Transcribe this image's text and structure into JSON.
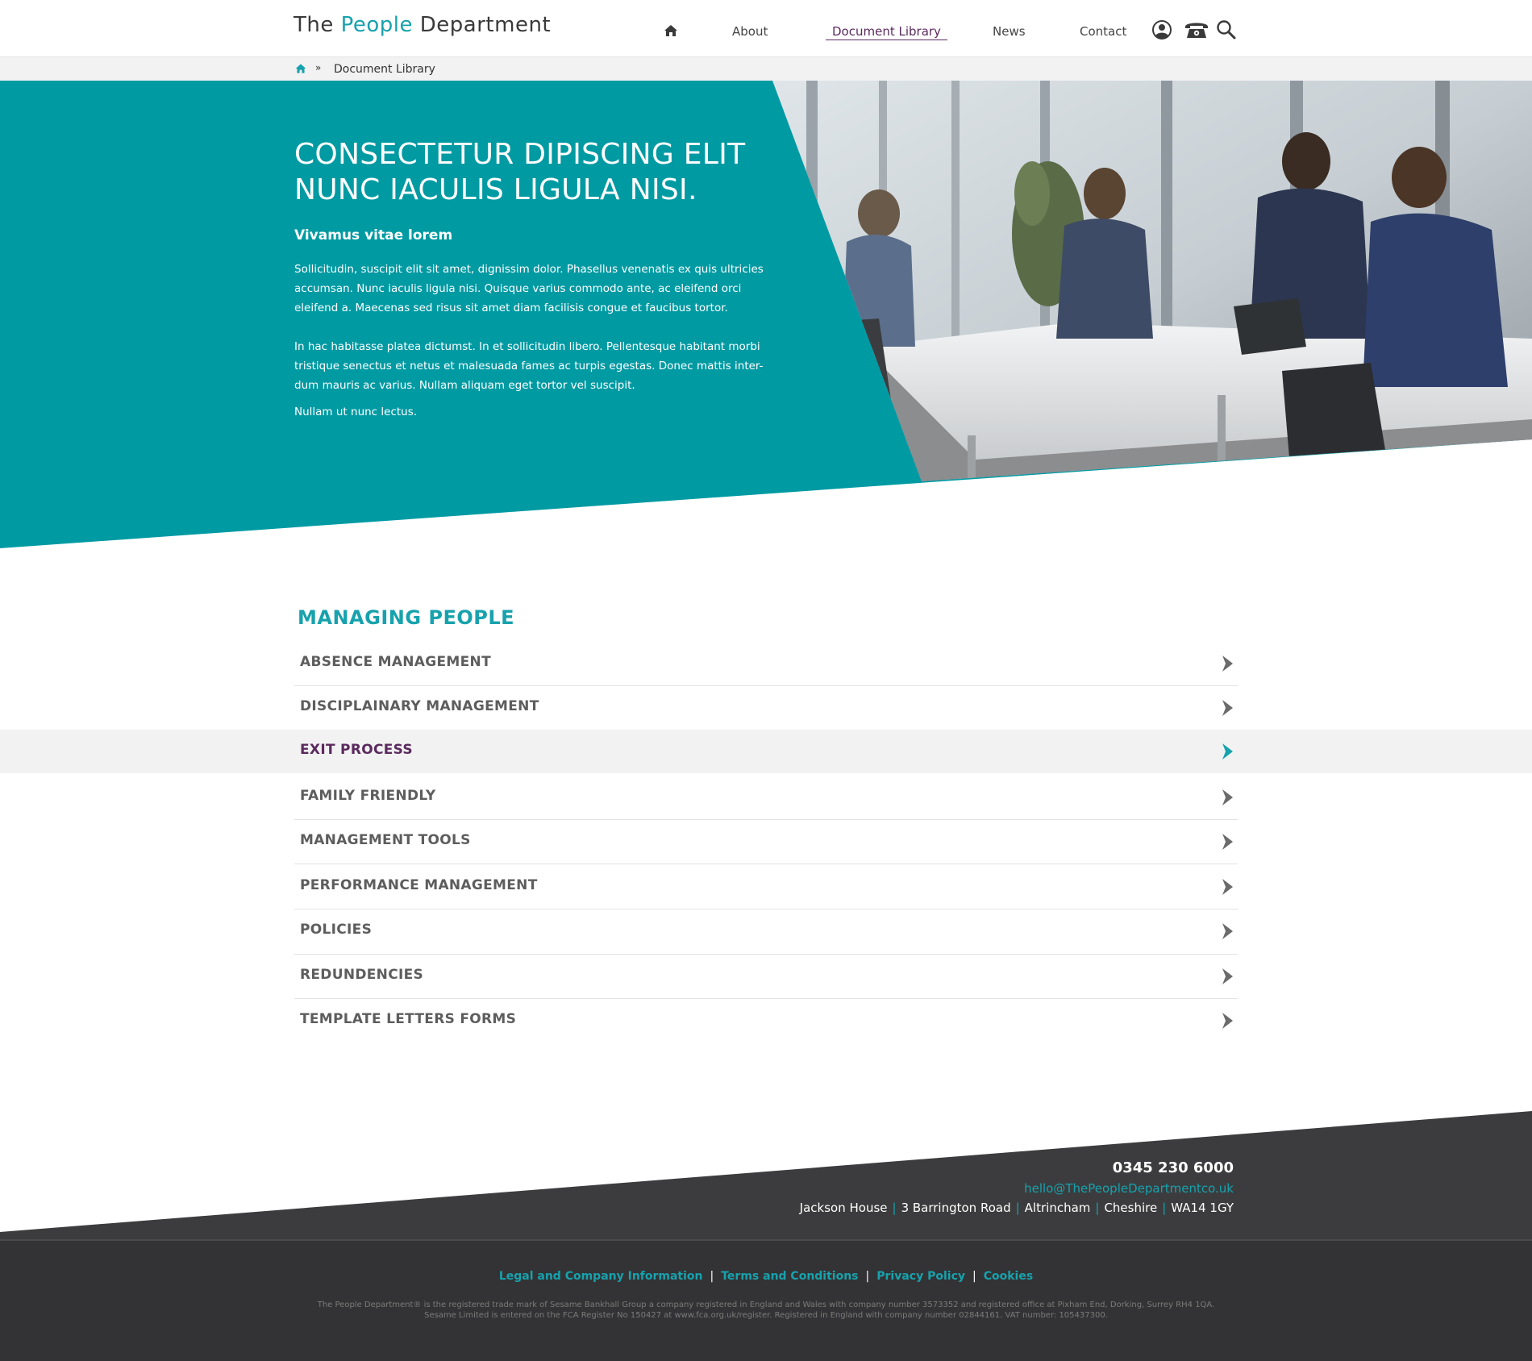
{
  "header": {
    "logo_pre": "The ",
    "logo_accent": "People",
    "logo_post": " Department",
    "nav": [
      "About",
      "Document Library",
      "News",
      "Contact"
    ],
    "active_nav": "Document Library"
  },
  "breadcrumb": {
    "current": "Document Library"
  },
  "hero": {
    "title": "CONSECTETUR DIPISCING ELIT NUNC IACULIS LIGULA NISI.",
    "subtitle": "Vivamus vitae lorem",
    "p1": "Sollicitudin, suscipit elit sit amet, dignissim dolor. Phasellus venenatis ex quis ultricies accumsan. Nunc iaculis ligula nisi. Quisque varius commodo ante, ac eleifend orci eleifend a. Maecenas sed risus sit amet diam facilisis congue et faucibus tortor.",
    "p2": "In hac habitasse platea dictumst. In et sollicitudin libero. Pellentesque habitant morbi tristique senectus et netus et malesuada fames ac turpis egestas. Donec mattis inter-dum mauris ac varius. Nullam aliquam eget tortor vel suscipit.",
    "p3": "Nullam ut nunc lectus."
  },
  "section": {
    "title": "MANAGING PEOPLE",
    "items": [
      "ABSENCE MANAGEMENT",
      "DISCIPLAINARY MANAGEMENT",
      "EXIT PROCESS",
      "FAMILY FRIENDLY",
      "MANAGEMENT TOOLS",
      "PERFORMANCE MANAGEMENT",
      "POLICIES",
      "REDUNDENCIES",
      "TEMPLATE LETTERS FORMS"
    ],
    "highlighted": "EXIT PROCESS"
  },
  "footer": {
    "phone": "0345 230 6000",
    "email": "hello@ThePeopleDepartmentco.uk",
    "address": [
      "Jackson House",
      "3 Barrington Road",
      "Altrincham",
      "Cheshire",
      "WA14 1GY"
    ],
    "links": [
      "Legal and Company Information",
      "Terms and Conditions",
      "Privacy Policy",
      "Cookies"
    ],
    "legal1": "The People Department® is the registered trade mark of Sesame Bankhall Group a company registered in England and Wales with company number 3573352 and registered office at Pixham End, Dorking, Surrey RH4 1QA.",
    "legal2": "Sesame Limited is entered on the FCA Register No 150427 at www.fca.org.uk/register. Registered in England with company number 02844161. VAT number: 105437300."
  },
  "colors": {
    "teal": "#17a2ad",
    "hero_teal": "#009aa3",
    "purple": "#5b2a5e",
    "footer_dark": "#3c3c3e",
    "footer_darker": "#333335"
  }
}
